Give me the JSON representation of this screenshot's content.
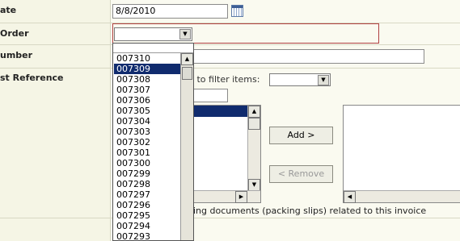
{
  "labels": {
    "date": "ate",
    "order": "Order",
    "number": "umber",
    "reference": "st Reference"
  },
  "date_field": {
    "value": "8/8/2010"
  },
  "order_dropdown": {
    "options": [
      "007310",
      "007309",
      "007308",
      "007307",
      "007306",
      "007305",
      "007304",
      "007303",
      "007302",
      "007301",
      "007300",
      "007299",
      "007298",
      "007297",
      "007296",
      "007295",
      "007294",
      "007293"
    ],
    "selected_index": 1
  },
  "filter": {
    "label": "w to filter items:"
  },
  "buttons": {
    "add": "Add >",
    "remove": "< Remove"
  },
  "note": "ing documents (packing slips) related to this invoice",
  "icons": {
    "calendar": "calendar-icon",
    "dropdown_arrow": "chevron-down-icon",
    "scroll_up": "scroll-up-icon",
    "scroll_down": "scroll-down-icon",
    "scroll_left": "scroll-left-icon",
    "scroll_right": "scroll-right-icon"
  },
  "colors": {
    "selected_row": "#102b6e",
    "required_border": "#b04040"
  }
}
